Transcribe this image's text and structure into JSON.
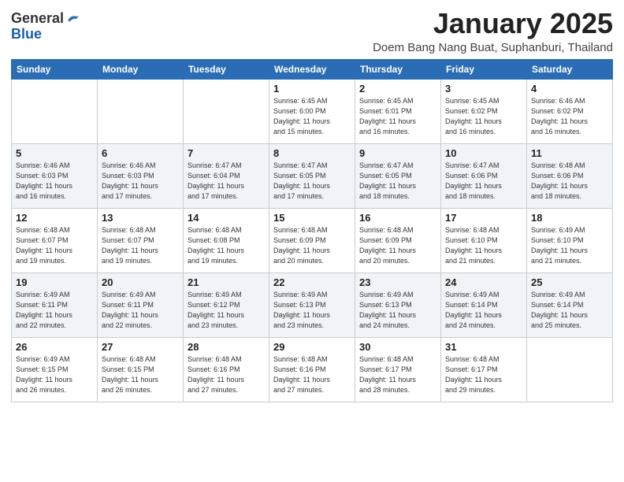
{
  "logo": {
    "general": "General",
    "blue": "Blue"
  },
  "header": {
    "month": "January 2025",
    "location": "Doem Bang Nang Buat, Suphanburi, Thailand"
  },
  "days_of_week": [
    "Sunday",
    "Monday",
    "Tuesday",
    "Wednesday",
    "Thursday",
    "Friday",
    "Saturday"
  ],
  "weeks": [
    [
      {
        "day": "",
        "info": ""
      },
      {
        "day": "",
        "info": ""
      },
      {
        "day": "",
        "info": ""
      },
      {
        "day": "1",
        "info": "Sunrise: 6:45 AM\nSunset: 6:00 PM\nDaylight: 11 hours\nand 15 minutes."
      },
      {
        "day": "2",
        "info": "Sunrise: 6:45 AM\nSunset: 6:01 PM\nDaylight: 11 hours\nand 16 minutes."
      },
      {
        "day": "3",
        "info": "Sunrise: 6:45 AM\nSunset: 6:02 PM\nDaylight: 11 hours\nand 16 minutes."
      },
      {
        "day": "4",
        "info": "Sunrise: 6:46 AM\nSunset: 6:02 PM\nDaylight: 11 hours\nand 16 minutes."
      }
    ],
    [
      {
        "day": "5",
        "info": "Sunrise: 6:46 AM\nSunset: 6:03 PM\nDaylight: 11 hours\nand 16 minutes."
      },
      {
        "day": "6",
        "info": "Sunrise: 6:46 AM\nSunset: 6:03 PM\nDaylight: 11 hours\nand 17 minutes."
      },
      {
        "day": "7",
        "info": "Sunrise: 6:47 AM\nSunset: 6:04 PM\nDaylight: 11 hours\nand 17 minutes."
      },
      {
        "day": "8",
        "info": "Sunrise: 6:47 AM\nSunset: 6:05 PM\nDaylight: 11 hours\nand 17 minutes."
      },
      {
        "day": "9",
        "info": "Sunrise: 6:47 AM\nSunset: 6:05 PM\nDaylight: 11 hours\nand 18 minutes."
      },
      {
        "day": "10",
        "info": "Sunrise: 6:47 AM\nSunset: 6:06 PM\nDaylight: 11 hours\nand 18 minutes."
      },
      {
        "day": "11",
        "info": "Sunrise: 6:48 AM\nSunset: 6:06 PM\nDaylight: 11 hours\nand 18 minutes."
      }
    ],
    [
      {
        "day": "12",
        "info": "Sunrise: 6:48 AM\nSunset: 6:07 PM\nDaylight: 11 hours\nand 19 minutes."
      },
      {
        "day": "13",
        "info": "Sunrise: 6:48 AM\nSunset: 6:07 PM\nDaylight: 11 hours\nand 19 minutes."
      },
      {
        "day": "14",
        "info": "Sunrise: 6:48 AM\nSunset: 6:08 PM\nDaylight: 11 hours\nand 19 minutes."
      },
      {
        "day": "15",
        "info": "Sunrise: 6:48 AM\nSunset: 6:09 PM\nDaylight: 11 hours\nand 20 minutes."
      },
      {
        "day": "16",
        "info": "Sunrise: 6:48 AM\nSunset: 6:09 PM\nDaylight: 11 hours\nand 20 minutes."
      },
      {
        "day": "17",
        "info": "Sunrise: 6:48 AM\nSunset: 6:10 PM\nDaylight: 11 hours\nand 21 minutes."
      },
      {
        "day": "18",
        "info": "Sunrise: 6:49 AM\nSunset: 6:10 PM\nDaylight: 11 hours\nand 21 minutes."
      }
    ],
    [
      {
        "day": "19",
        "info": "Sunrise: 6:49 AM\nSunset: 6:11 PM\nDaylight: 11 hours\nand 22 minutes."
      },
      {
        "day": "20",
        "info": "Sunrise: 6:49 AM\nSunset: 6:11 PM\nDaylight: 11 hours\nand 22 minutes."
      },
      {
        "day": "21",
        "info": "Sunrise: 6:49 AM\nSunset: 6:12 PM\nDaylight: 11 hours\nand 23 minutes."
      },
      {
        "day": "22",
        "info": "Sunrise: 6:49 AM\nSunset: 6:13 PM\nDaylight: 11 hours\nand 23 minutes."
      },
      {
        "day": "23",
        "info": "Sunrise: 6:49 AM\nSunset: 6:13 PM\nDaylight: 11 hours\nand 24 minutes."
      },
      {
        "day": "24",
        "info": "Sunrise: 6:49 AM\nSunset: 6:14 PM\nDaylight: 11 hours\nand 24 minutes."
      },
      {
        "day": "25",
        "info": "Sunrise: 6:49 AM\nSunset: 6:14 PM\nDaylight: 11 hours\nand 25 minutes."
      }
    ],
    [
      {
        "day": "26",
        "info": "Sunrise: 6:49 AM\nSunset: 6:15 PM\nDaylight: 11 hours\nand 26 minutes."
      },
      {
        "day": "27",
        "info": "Sunrise: 6:48 AM\nSunset: 6:15 PM\nDaylight: 11 hours\nand 26 minutes."
      },
      {
        "day": "28",
        "info": "Sunrise: 6:48 AM\nSunset: 6:16 PM\nDaylight: 11 hours\nand 27 minutes."
      },
      {
        "day": "29",
        "info": "Sunrise: 6:48 AM\nSunset: 6:16 PM\nDaylight: 11 hours\nand 27 minutes."
      },
      {
        "day": "30",
        "info": "Sunrise: 6:48 AM\nSunset: 6:17 PM\nDaylight: 11 hours\nand 28 minutes."
      },
      {
        "day": "31",
        "info": "Sunrise: 6:48 AM\nSunset: 6:17 PM\nDaylight: 11 hours\nand 29 minutes."
      },
      {
        "day": "",
        "info": ""
      }
    ]
  ]
}
